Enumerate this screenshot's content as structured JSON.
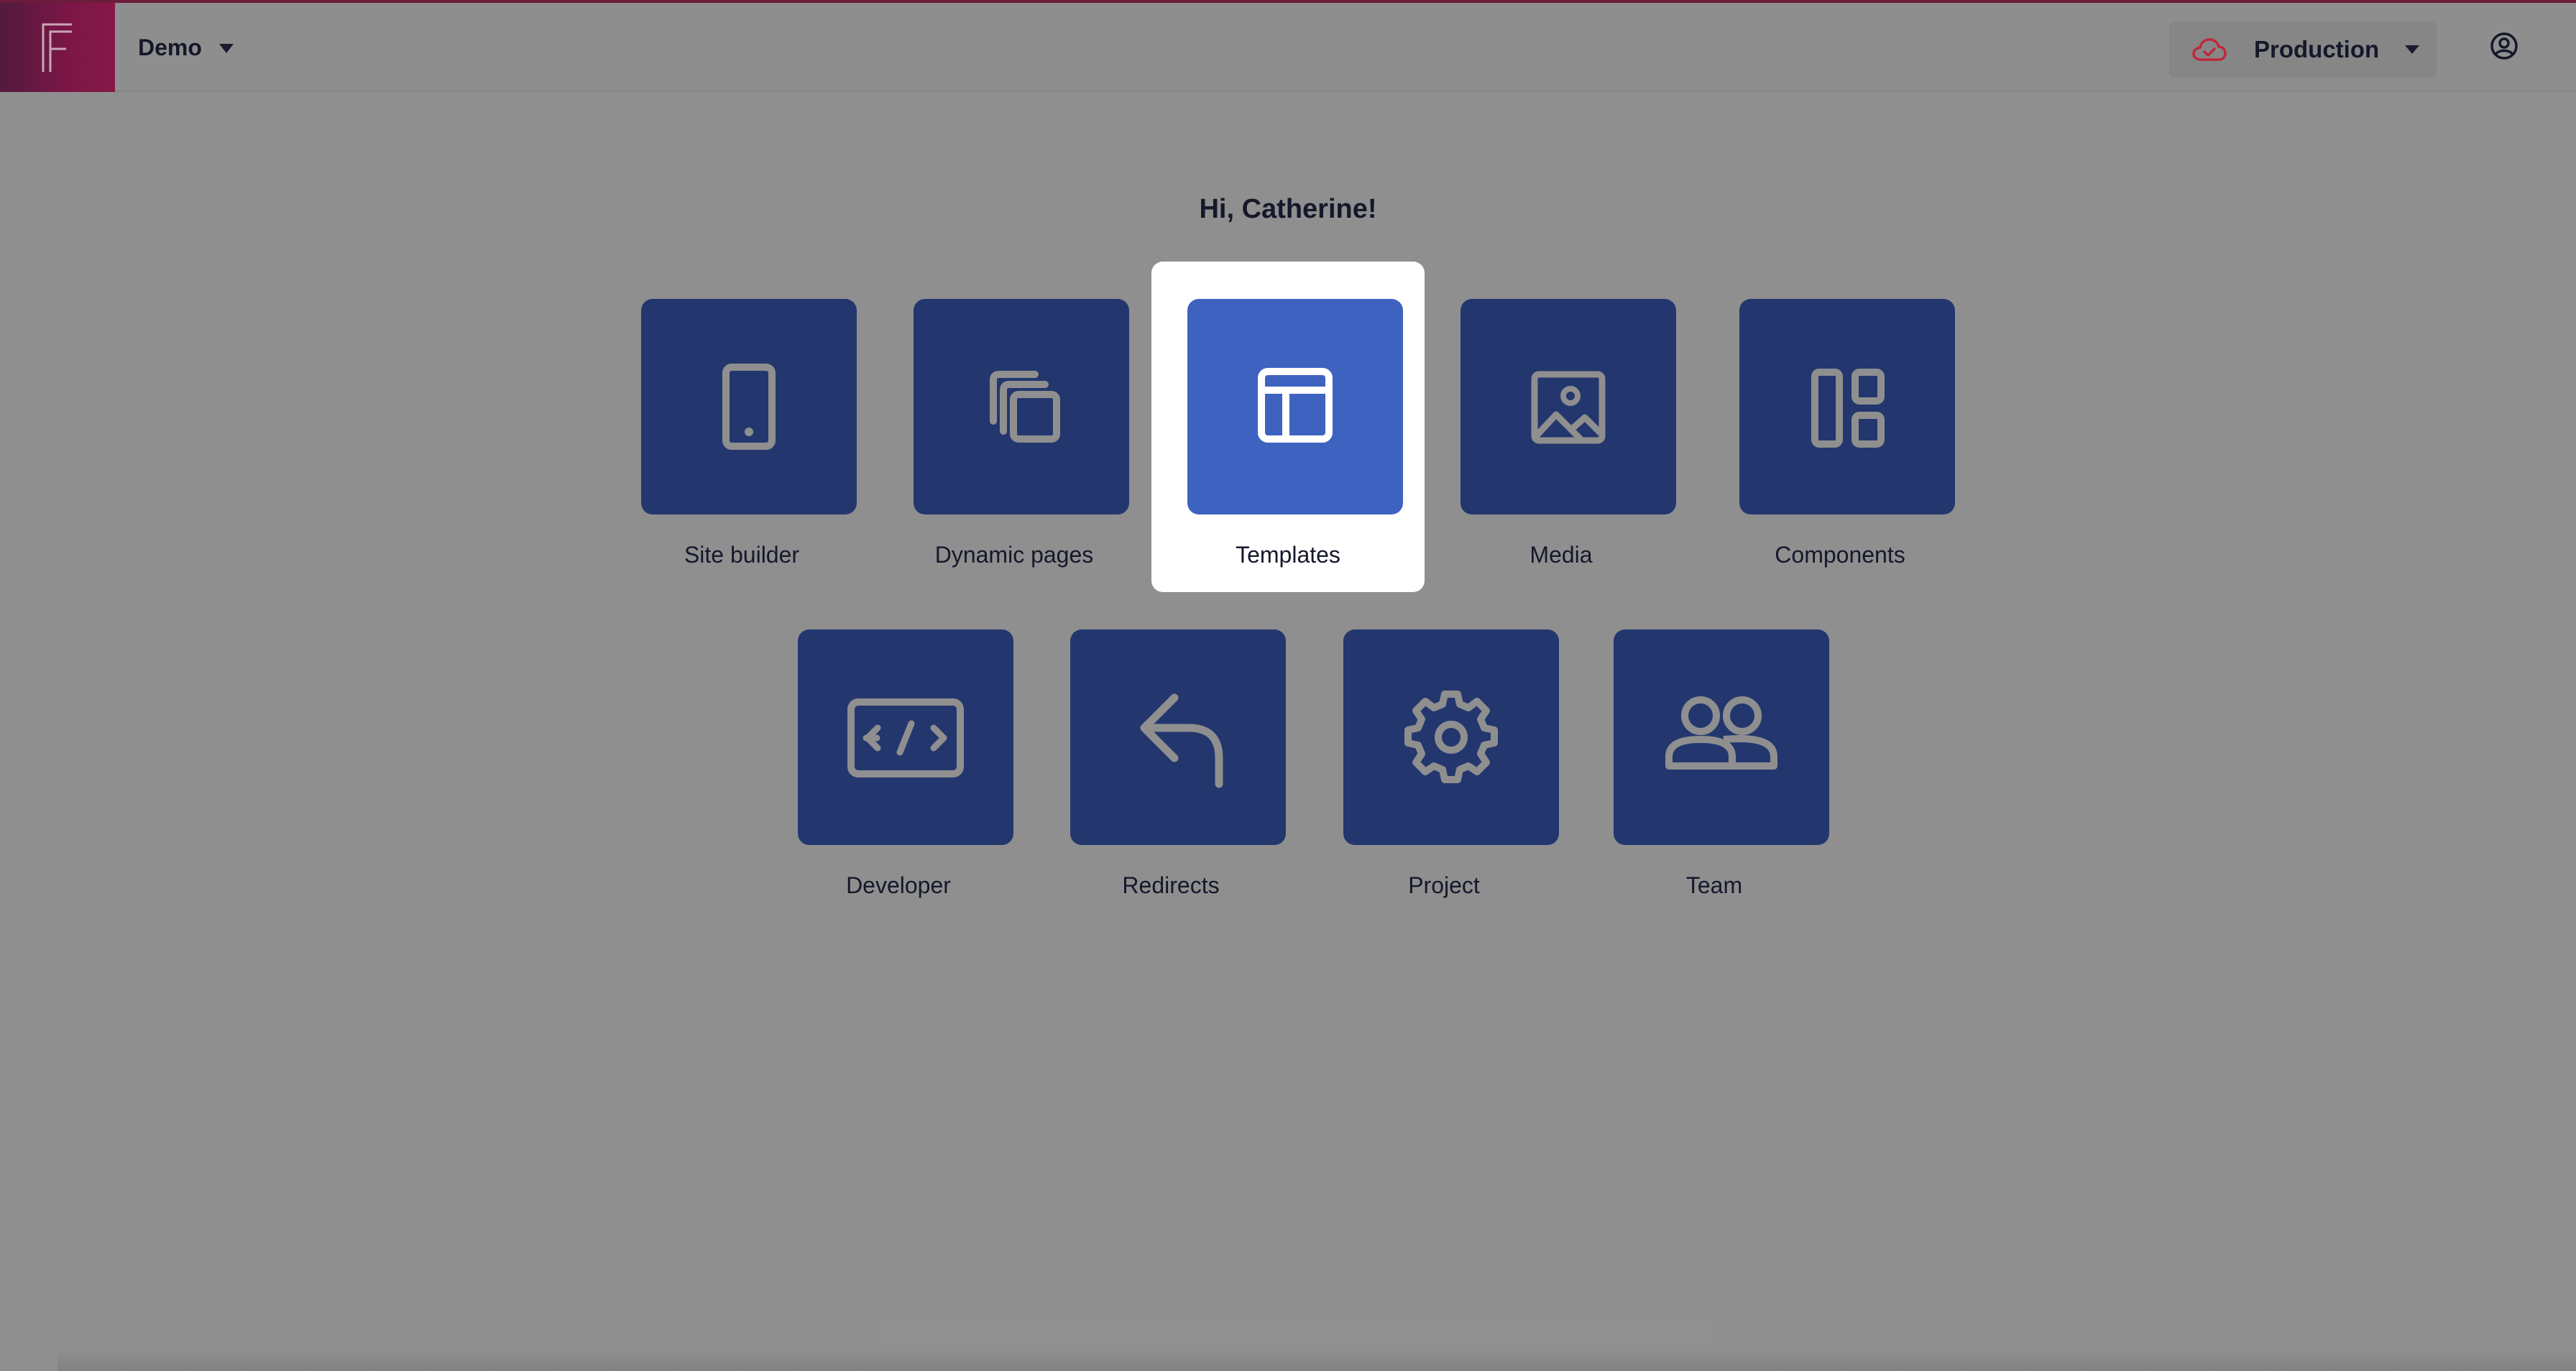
{
  "header": {
    "project_name": "Demo",
    "environment": "Production",
    "logo_letter": "F"
  },
  "main": {
    "greeting": "Hi, Catherine!",
    "tiles": [
      {
        "label": "Site builder",
        "icon": "tablet-icon",
        "selected": false
      },
      {
        "label": "Dynamic pages",
        "icon": "stacked-pages-icon",
        "selected": false
      },
      {
        "label": "Templates",
        "icon": "template-layout-icon",
        "selected": true
      },
      {
        "label": "Media",
        "icon": "image-icon",
        "selected": false
      },
      {
        "label": "Components",
        "icon": "layout-blocks-icon",
        "selected": false
      },
      {
        "label": "Developer",
        "icon": "code-icon",
        "selected": false
      },
      {
        "label": "Redirects",
        "icon": "reply-arrow-icon",
        "selected": false
      },
      {
        "label": "Project",
        "icon": "gear-icon",
        "selected": false
      },
      {
        "label": "Team",
        "icon": "users-icon",
        "selected": false
      }
    ]
  },
  "colors": {
    "tile": "#23376e",
    "tile_selected": "#3e62c0",
    "icon_stroke": "#8f8f8f",
    "brand": "#7c1646",
    "cloud_accent": "#c0283c"
  }
}
